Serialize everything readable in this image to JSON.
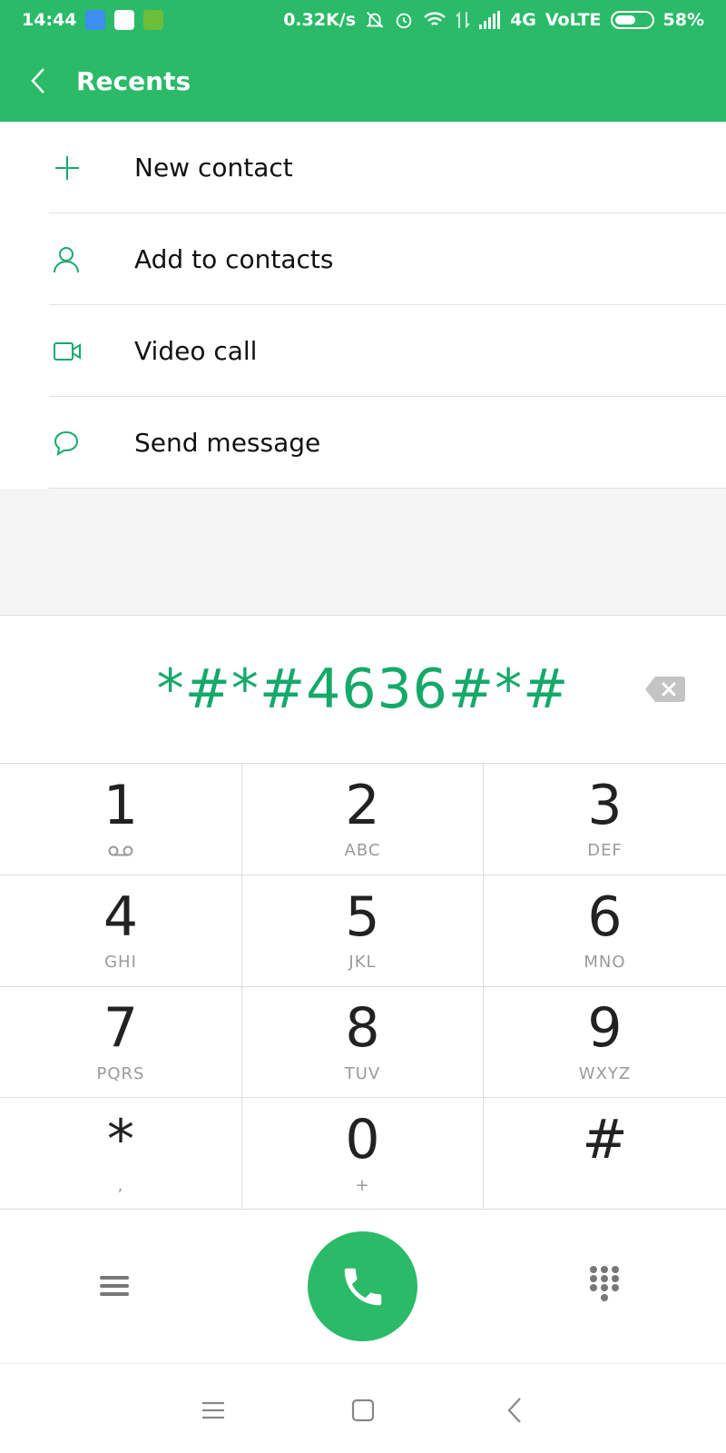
{
  "status_bar": {
    "time": "14:44",
    "net_speed": "0.32K/s",
    "network": "4G",
    "volte": "VoLTE",
    "battery_percent": "58%",
    "battery_level": 0.58
  },
  "header": {
    "title": "Recents"
  },
  "menu": {
    "items": [
      {
        "label": "New contact",
        "icon": "plus-icon"
      },
      {
        "label": "Add to contacts",
        "icon": "person-icon"
      },
      {
        "label": "Video call",
        "icon": "video-camera-icon"
      },
      {
        "label": "Send message",
        "icon": "message-bubble-icon"
      }
    ]
  },
  "dialer": {
    "number": "*#*#4636#*#"
  },
  "keypad": {
    "keys": [
      {
        "digit": "1",
        "letters": ""
      },
      {
        "digit": "2",
        "letters": "ABC"
      },
      {
        "digit": "3",
        "letters": "DEF"
      },
      {
        "digit": "4",
        "letters": "GHI"
      },
      {
        "digit": "5",
        "letters": "JKL"
      },
      {
        "digit": "6",
        "letters": "MNO"
      },
      {
        "digit": "7",
        "letters": "PQRS"
      },
      {
        "digit": "8",
        "letters": "TUV"
      },
      {
        "digit": "9",
        "letters": "WXYZ"
      },
      {
        "digit": "*",
        "letters": ","
      },
      {
        "digit": "0",
        "letters": "+"
      },
      {
        "digit": "#",
        "letters": ""
      }
    ]
  },
  "colors": {
    "brand_green": "#2bba68",
    "number_green": "#16a96a"
  }
}
